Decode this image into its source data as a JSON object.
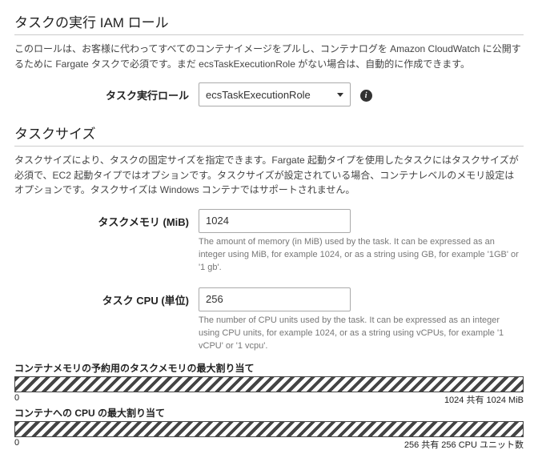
{
  "iam": {
    "title": "タスクの実行 IAM ロール",
    "desc": "このロールは、お客様に代わってすべてのコンテナイメージをプルし、コンテナログを Amazon CloudWatch に公開するために Fargate タスクで必須です。まだ ecsTaskExecutionRole がない場合は、自動的に作成できます。",
    "role_label": "タスク実行ロール",
    "role_value": "ecsTaskExecutionRole"
  },
  "size": {
    "title": "タスクサイズ",
    "desc": "タスクサイズにより、タスクの固定サイズを指定できます。Fargate 起動タイプを使用したタスクにはタスクサイズが必須で、EC2 起動タイプではオプションです。タスクサイズが設定されている場合、コンテナレベルのメモリ設定はオプションです。タスクサイズは Windows コンテナではサポートされません。",
    "mem_label": "タスクメモリ (MiB)",
    "mem_value": "1024",
    "mem_hint": "The amount of memory (in MiB) used by the task. It can be expressed as an integer using MiB, for example 1024, or as a string using GB, for example '1GB' or '1 gb'.",
    "cpu_label": "タスク CPU (単位)",
    "cpu_value": "256",
    "cpu_hint": "The number of CPU units used by the task. It can be expressed as an integer using CPU units, for example 1024, or as a string using vCPUs, for example '1 vCPU' or '1 vcpu'."
  },
  "bars": {
    "mem_label": "コンテナメモリの予約用のタスクメモリの最大割り当て",
    "mem_min": "0",
    "mem_max": "1024 共有 1024 MiB",
    "cpu_label": "コンテナへの CPU の最大割り当て",
    "cpu_min": "0",
    "cpu_max": "256 共有 256 CPU ユニット数"
  }
}
